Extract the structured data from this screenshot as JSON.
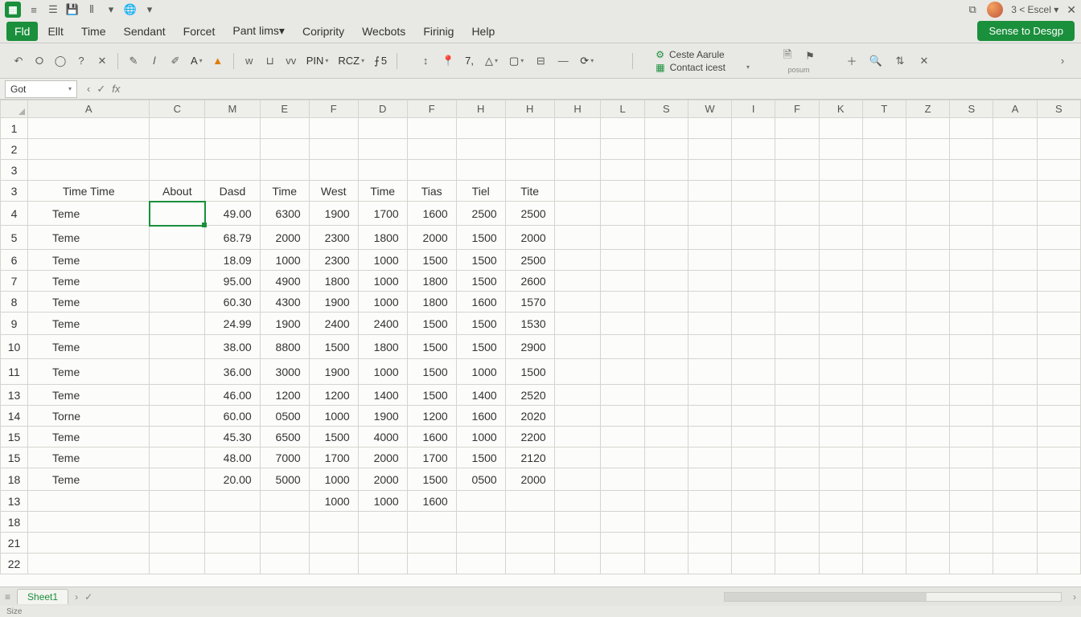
{
  "titlebar": {
    "doc_hint": "3 < Escel ▾",
    "logo_glyph": "▦"
  },
  "menu": {
    "items": [
      "Fld",
      "Ellt",
      "Time",
      "Sendant",
      "Forcet",
      "Pant lims▾",
      "Coriprity",
      "Wecbots",
      "Firinig",
      "Help"
    ],
    "share_label": "Sense to Desgp"
  },
  "toolbar": {
    "font_label": "PIN",
    "size_label": "RCZ",
    "fx_label": "5",
    "num_label": "7,",
    "right_a": "Ceste Aarule",
    "right_b": "Contact icest",
    "small_caption": "posum"
  },
  "namebox": {
    "value": "Got"
  },
  "columns": [
    "A",
    "C",
    "M",
    "E",
    "F",
    "D",
    "F",
    "H",
    "H",
    "H",
    "L",
    "S",
    "W",
    "I",
    "F",
    "K",
    "T",
    "Z",
    "S",
    "A",
    "S"
  ],
  "row_numbers": [
    "1",
    "2",
    "3",
    "3",
    "4",
    "5",
    "6",
    "7",
    "8",
    "9",
    "10",
    "11",
    "13",
    "14",
    "15",
    "15",
    "18",
    "13",
    "18",
    "21",
    "22"
  ],
  "headers": {
    "A": "Time Time",
    "C": "About",
    "M": "Dasd",
    "E": "Time",
    "Fa": "West",
    "D": "Time",
    "Fb": "Tias",
    "H": "Tiel",
    "Hb": "Tite"
  },
  "rows": [
    {
      "A": "Teme",
      "M": "49.00",
      "E": "6300",
      "Fa": "1900",
      "D": "1700",
      "Fb": "1600",
      "H": "2500",
      "Hb": "2500"
    },
    {
      "A": "Teme",
      "M": "68.79",
      "E": "2000",
      "Fa": "2300",
      "D": "1800",
      "Fb": "2000",
      "H": "1500",
      "Hb": "2000"
    },
    {
      "A": "Teme",
      "M": "18.09",
      "E": "1000",
      "Fa": "2300",
      "D": "1000",
      "Fb": "1500",
      "H": "1500",
      "Hb": "2500"
    },
    {
      "A": "Teme",
      "M": "95.00",
      "E": "4900",
      "Fa": "1800",
      "D": "1000",
      "Fb": "1800",
      "H": "1500",
      "Hb": "2600"
    },
    {
      "A": "Teme",
      "M": "60.30",
      "E": "4300",
      "Fa": "1900",
      "D": "1000",
      "Fb": "1800",
      "H": "1600",
      "Hb": "1570"
    },
    {
      "A": "Teme",
      "M": "24.99",
      "E": "1900",
      "Fa": "2400",
      "D": "2400",
      "Fb": "1500",
      "H": "1500",
      "Hb": "1530"
    },
    {
      "A": "Teme",
      "M": "38.00",
      "E": "8800",
      "Fa": "1500",
      "D": "1800",
      "Fb": "1500",
      "H": "1500",
      "Hb": "2900"
    },
    {
      "A": "Teme",
      "M": "36.00",
      "E": "3000",
      "Fa": "1900",
      "D": "1000",
      "Fb": "1500",
      "H": "1000",
      "Hb": "1500"
    },
    {
      "A": "Teme",
      "M": "46.00",
      "E": "1200",
      "Fa": "1200",
      "D": "1400",
      "Fb": "1500",
      "H": "1400",
      "Hb": "2520"
    },
    {
      "A": "Torne",
      "M": "60.00",
      "E": "0500",
      "Fa": "1000",
      "D": "1900",
      "Fb": "1200",
      "H": "1600",
      "Hb": "2020"
    },
    {
      "A": "Teme",
      "M": "45.30",
      "E": "6500",
      "Fa": "1500",
      "D": "4000",
      "Fb": "1600",
      "H": "1000",
      "Hb": "2200"
    },
    {
      "A": "Teme",
      "M": "48.00",
      "E": "7000",
      "Fa": "1700",
      "D": "2000",
      "Fb": "1700",
      "H": "1500",
      "Hb": "2120"
    },
    {
      "A": "Teme",
      "M": "20.00",
      "E": "5000",
      "Fa": "1000",
      "D": "2000",
      "Fb": "1500",
      "H": "0500",
      "Hb": "2000"
    },
    {
      "A": "",
      "M": "",
      "E": "",
      "Fa": "1000",
      "D": "1000",
      "Fb": "1600",
      "H": "",
      "Hb": ""
    }
  ],
  "sheet_tab": "Sheet1",
  "status": "Size",
  "chart_data": {
    "type": "table",
    "title": "Time Time",
    "columns": [
      "About",
      "Dasd",
      "Time",
      "West",
      "Time",
      "Tias",
      "Tiel",
      "Tite"
    ],
    "series": [
      {
        "name": "Dasd",
        "values": [
          49.0,
          68.79,
          18.09,
          95.0,
          60.3,
          24.99,
          38.0,
          36.0,
          46.0,
          60.0,
          45.3,
          48.0,
          20.0
        ]
      },
      {
        "name": "Time",
        "values": [
          6300,
          2000,
          1000,
          4900,
          4300,
          1900,
          8800,
          3000,
          1200,
          500,
          6500,
          7000,
          5000
        ]
      },
      {
        "name": "West",
        "values": [
          1900,
          2300,
          2300,
          1800,
          1900,
          2400,
          1500,
          1900,
          1200,
          1000,
          1500,
          1700,
          1000,
          1000
        ]
      },
      {
        "name": "Time2",
        "values": [
          1700,
          1800,
          1000,
          1000,
          1000,
          2400,
          1800,
          1000,
          1400,
          1900,
          4000,
          2000,
          2000,
          1000
        ]
      },
      {
        "name": "Tias",
        "values": [
          1600,
          2000,
          1500,
          1800,
          1800,
          1500,
          1500,
          1500,
          1500,
          1200,
          1600,
          1700,
          1500,
          1600
        ]
      },
      {
        "name": "Tiel",
        "values": [
          2500,
          1500,
          1500,
          1500,
          1600,
          1500,
          1500,
          1000,
          1400,
          1600,
          1000,
          1500,
          500
        ]
      },
      {
        "name": "Tite",
        "values": [
          2500,
          2000,
          2500,
          2600,
          1570,
          1530,
          2900,
          1500,
          2520,
          2020,
          2200,
          2120,
          2000
        ]
      }
    ]
  }
}
